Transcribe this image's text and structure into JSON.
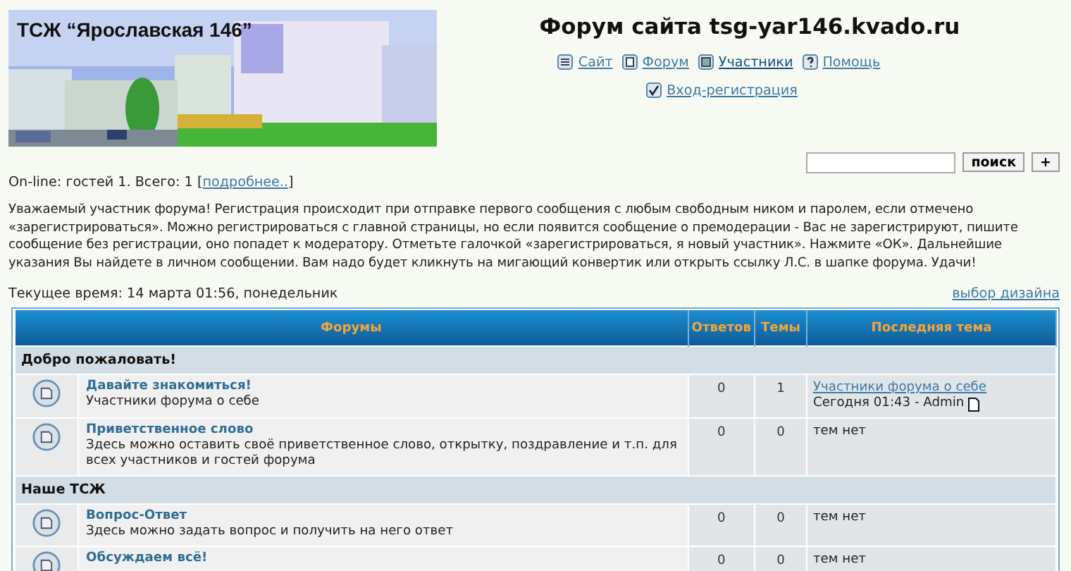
{
  "banner": {
    "title": "ТСЖ “Ярославская 146”"
  },
  "site_title": "Форум сайта tsg-yar146.kvado.ru",
  "nav": [
    {
      "kind": "site",
      "label": "Сайт"
    },
    {
      "kind": "forum",
      "label": "Форум"
    },
    {
      "kind": "members",
      "label": "Участники"
    },
    {
      "kind": "help",
      "label": "Помощь"
    }
  ],
  "login_link": "Вход-регистрация",
  "search": {
    "button": "поиск",
    "extra_button": "+"
  },
  "online": {
    "text": "On-line: гостей 1. Всего: 1 [",
    "link": "подробнее..",
    "suffix": "]"
  },
  "notice": "Уважаемый участник форума! Регистрация происходит при отправке первого сообщения с любым свободным ником и паролем, если отмечено «зарегистрироваться». Можно регистрироваться с главной страницы, но если появится сообщение о премодерации - Вас не зарегистрируют, пишите сообщение без регистрации, оно попадет к модератору. Отметьте галочкой «зарегистрироваться, я новый участник». Нажмите «ОК». Дальнейшие указания Вы найдете в личном сообщении. Вам надо будет кликнуть на мигающий конвертик или открыть ссылку Л.С. в шапке форума. Удачи!",
  "current_time": "Текущее время: 14 марта 01:56, понедельник",
  "design_link": "выбор дизайна",
  "table": {
    "columns": [
      "Форумы",
      "Ответов",
      "Темы",
      "Последняя тема"
    ],
    "categories": [
      {
        "title": "Добро пожаловать!",
        "forums": [
          {
            "name": "Давайте знакомиться!",
            "description": "Участники форума о себе",
            "replies": "0",
            "topics": "1",
            "last_topic": {
              "kind": "post",
              "title": "Участники форума о себе",
              "meta": "Сегодня 01:43 - Admin"
            }
          },
          {
            "name": "Приветственное слово",
            "description": "Здесь можно оставить своё приветственное слово, открытку, поздравление и т.п. для всех участников и гостей форума",
            "replies": "0",
            "topics": "0",
            "last_topic": {
              "kind": "none",
              "text": "тем нет"
            }
          }
        ]
      },
      {
        "title": "Наше ТСЖ",
        "forums": [
          {
            "name": "Вопрос-Ответ",
            "description": "Здесь можно задать вопрос и получить на него ответ",
            "replies": "0",
            "topics": "0",
            "last_topic": {
              "kind": "none",
              "text": "тем нет"
            }
          },
          {
            "name": "Обсуждаем всё!",
            "replies": "0",
            "topics": "0",
            "last_topic": {
              "kind": "none",
              "text": "тем нет"
            }
          }
        ]
      }
    ]
  }
}
